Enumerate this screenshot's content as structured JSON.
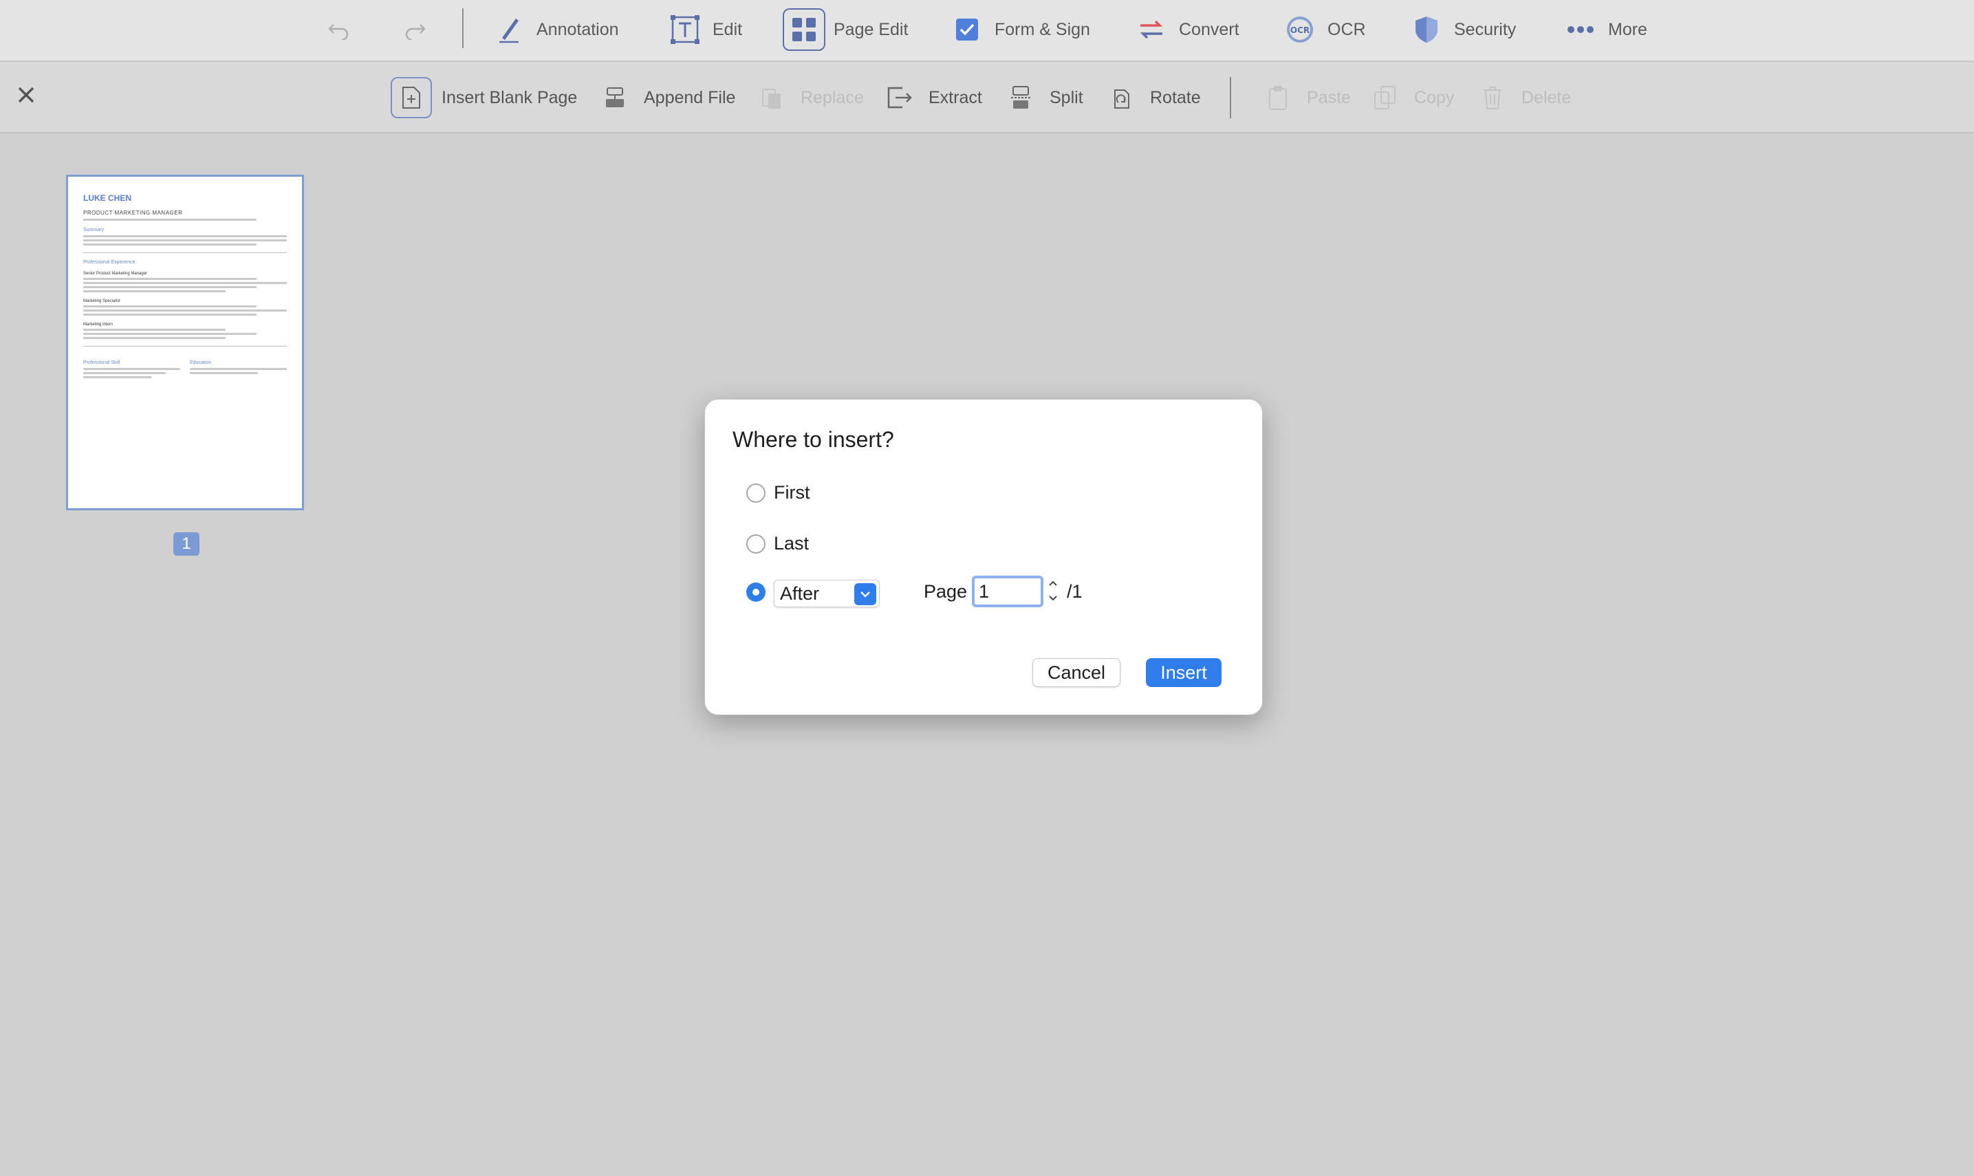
{
  "top_toolbar": {
    "undo_icon": "undo-icon",
    "redo_icon": "redo-icon",
    "items": [
      {
        "label": "Annotation",
        "icon": "pen-icon"
      },
      {
        "label": "Edit",
        "icon": "text-edit-icon"
      },
      {
        "label": "Page Edit",
        "icon": "grid-icon"
      },
      {
        "label": "Form & Sign",
        "icon": "checkbox-icon"
      },
      {
        "label": "Convert",
        "icon": "convert-icon"
      },
      {
        "label": "OCR",
        "icon": "ocr-icon"
      },
      {
        "label": "Security",
        "icon": "shield-icon"
      },
      {
        "label": "More",
        "icon": "more-dots-icon"
      }
    ]
  },
  "page_edit_toolbar": {
    "items": [
      {
        "label": "Insert Blank Page",
        "enabled": true
      },
      {
        "label": "Append File",
        "enabled": true
      },
      {
        "label": "Replace",
        "enabled": false
      },
      {
        "label": "Extract",
        "enabled": true
      },
      {
        "label": "Split",
        "enabled": true
      },
      {
        "label": "Rotate",
        "enabled": true
      },
      {
        "label": "Paste",
        "enabled": false
      },
      {
        "label": "Copy",
        "enabled": false
      },
      {
        "label": "Delete",
        "enabled": false
      }
    ]
  },
  "thumbnail": {
    "name": "LUKE CHEN",
    "role": "PRODUCT MARKETING MANAGER",
    "sections": [
      "Summary",
      "Professional Experience",
      "Professional Skill",
      "Education"
    ],
    "jobs": [
      "Senior Product Marketing Manager",
      "Marketing Specialist",
      "Marketing Intern"
    ],
    "page_number": "1"
  },
  "dialog": {
    "title": "Where to insert?",
    "option_first": "First",
    "option_last": "Last",
    "position_select_value": "After",
    "page_label": "Page",
    "page_value": "1",
    "page_total": "/1",
    "cancel_label": "Cancel",
    "insert_label": "Insert"
  },
  "colors": {
    "accent": "#2f7de8",
    "thumbnail_border": "#7e9fd6"
  }
}
